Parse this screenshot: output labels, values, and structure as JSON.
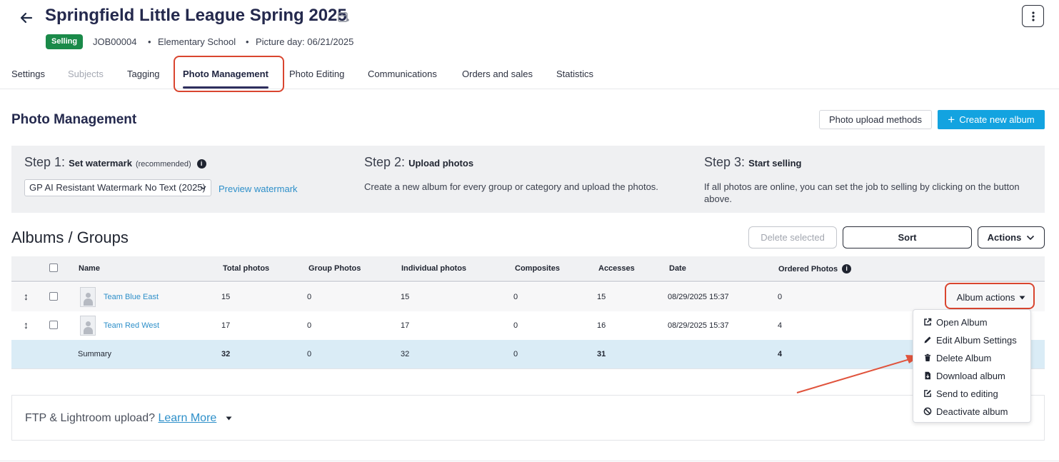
{
  "header": {
    "title": "Springfield Little League Spring 2025",
    "status_badge": "Selling",
    "job_id": "JOB00004",
    "school_type": "Elementary School",
    "picture_day": "Picture day: 06/21/2025",
    "separator": "•"
  },
  "tabs": [
    {
      "label": "Settings",
      "state": "normal"
    },
    {
      "label": "Subjects",
      "state": "disabled"
    },
    {
      "label": "Tagging",
      "state": "normal"
    },
    {
      "label": "Photo Management",
      "state": "active"
    },
    {
      "label": "Photo Editing",
      "state": "normal"
    },
    {
      "label": "Communications",
      "state": "normal"
    },
    {
      "label": "Orders and sales",
      "state": "normal"
    },
    {
      "label": "Statistics",
      "state": "normal"
    }
  ],
  "section": {
    "title": "Photo Management",
    "upload_methods_label": "Photo upload methods",
    "create_album_label": "Create new album",
    "create_album_icon": "+"
  },
  "steps": {
    "step1_prefix": "Step 1:",
    "step1_title": "Set watermark",
    "step1_note": "(recommended)",
    "info_glyph": "i",
    "watermark_value": "GP AI Resistant Watermark No Text (2025)",
    "preview_label": "Preview watermark",
    "step2_prefix": "Step 2:",
    "step2_title": "Upload photos",
    "step2_text": "Create a new album for every group or category and upload the photos.",
    "step3_prefix": "Step 3:",
    "step3_title": "Start selling",
    "step3_text": "If all photos are online, you can set the job to selling by clicking on the button above."
  },
  "albums": {
    "title": "Albums / Groups",
    "delete_selected_label": "Delete selected",
    "sort_label": "Sort",
    "actions_label": "Actions",
    "columns": [
      "Name",
      "Total photos",
      "Group Photos",
      "Individual photos",
      "Composites",
      "Accesses",
      "Date",
      "Ordered Photos"
    ],
    "rows": [
      {
        "name": "Team Blue East",
        "total": "15",
        "group": "0",
        "individual": "15",
        "composites": "0",
        "accesses": "15",
        "date": "08/29/2025 15:37",
        "ordered": "0"
      },
      {
        "name": "Team Red West",
        "total": "17",
        "group": "0",
        "individual": "17",
        "composites": "0",
        "accesses": "16",
        "date": "08/29/2025 15:37",
        "ordered": "4"
      }
    ],
    "summary": {
      "label": "Summary",
      "total": "32",
      "group": "0",
      "individual": "32",
      "composites": "0",
      "accesses": "31",
      "ordered": "4"
    },
    "album_actions_label": "Album actions"
  },
  "album_menu": {
    "items": [
      {
        "label": "Open Album",
        "icon": "external-link-icon"
      },
      {
        "label": "Edit Album Settings",
        "icon": "pencil-icon"
      },
      {
        "label": "Delete Album",
        "icon": "trash-icon"
      },
      {
        "label": "Download album",
        "icon": "file-download-icon"
      },
      {
        "label": "Send to editing",
        "icon": "edit-square-icon"
      },
      {
        "label": "Deactivate album",
        "icon": "ban-icon"
      }
    ]
  },
  "ftp": {
    "question": "FTP & Lightroom upload?",
    "learn_more": "Learn More"
  },
  "colors": {
    "accent": "#13a3e0",
    "selling_badge": "#1a8a49",
    "link": "#2d8fc9",
    "annotation_red": "#d9452f",
    "title_navy": "#24294d"
  }
}
